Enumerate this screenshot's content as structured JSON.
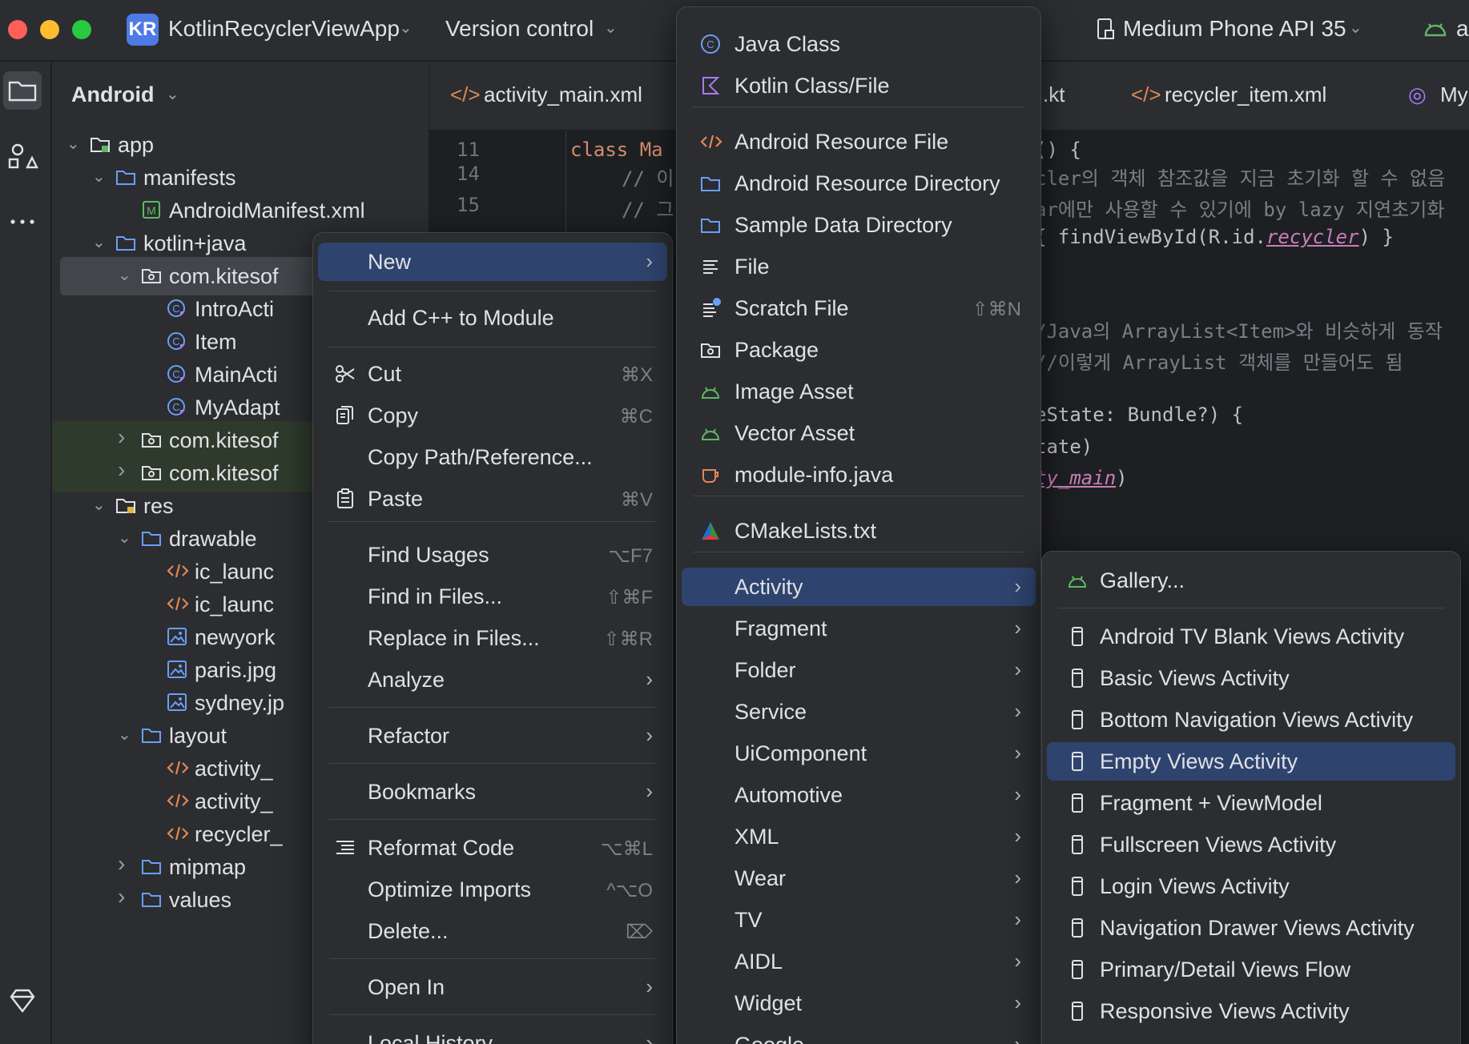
{
  "titlebar": {
    "project_badge": "KR",
    "project_name": "KotlinRecyclerViewApp",
    "vcs": "Version control",
    "device": "Medium Phone API 35",
    "run_partial": "a"
  },
  "project_panel": {
    "view": "Android",
    "tree": [
      {
        "label": "app",
        "icon": "module-icon"
      },
      {
        "label": "manifests",
        "icon": "folder-icon"
      },
      {
        "label": "AndroidManifest.xml",
        "icon": "manifest-icon"
      },
      {
        "label": "kotlin+java",
        "icon": "folder-icon"
      },
      {
        "label": "com.kitesof",
        "icon": "package-icon"
      },
      {
        "label": "IntroActi",
        "icon": "kotlin-class-icon"
      },
      {
        "label": "Item",
        "icon": "kotlin-class-icon"
      },
      {
        "label": "MainActi",
        "icon": "kotlin-class-icon"
      },
      {
        "label": "MyAdapt",
        "icon": "kotlin-class-icon"
      },
      {
        "label": "com.kitesof",
        "icon": "package-icon"
      },
      {
        "label": "com.kitesof",
        "icon": "package-icon"
      },
      {
        "label": "res",
        "icon": "res-folder-icon"
      },
      {
        "label": "drawable",
        "icon": "folder-icon"
      },
      {
        "label": "ic_launc",
        "icon": "xml-icon"
      },
      {
        "label": "ic_launc",
        "icon": "xml-icon"
      },
      {
        "label": "newyork",
        "icon": "image-icon"
      },
      {
        "label": "paris.jpg",
        "icon": "image-icon"
      },
      {
        "label": "sydney.jp",
        "icon": "image-icon"
      },
      {
        "label": "layout",
        "icon": "folder-icon"
      },
      {
        "label": "activity_",
        "icon": "xml-icon"
      },
      {
        "label": "activity_",
        "icon": "xml-icon"
      },
      {
        "label": "recycler_",
        "icon": "xml-icon"
      },
      {
        "label": "mipmap",
        "icon": "folder-icon"
      },
      {
        "label": "values",
        "icon": "folder-icon"
      }
    ]
  },
  "editor": {
    "tabs": [
      "activity_main.xml",
      ".kt",
      "recycler_item.xml",
      "My"
    ],
    "code": [
      {
        "no": "11",
        "text": "class Ma",
        "tail": "() {"
      },
      {
        "no": "14",
        "text": "// 이",
        "tail": "cler의 객체 참조값을 지금 초기화 할 수 없음"
      },
      {
        "no": "15",
        "text": "// 그",
        "tail": "ar에만 사용할 수 있기에 by lazy 지연초기화"
      },
      {
        "no": "",
        "text": "",
        "tail": " { findViewById(R.id.",
        "link": "recycler",
        "end": ") }"
      },
      {
        "no": "",
        "text": "",
        "tail": "/Java의 ArrayList<Item>와 비슷하게 동작"
      },
      {
        "no": "",
        "text": "",
        "tail": "//이렇게 ArrayList 객체를 만들어도 됨"
      },
      {
        "no": "",
        "text": "",
        "tail": "eState: Bundle?) {"
      },
      {
        "no": "",
        "text": "",
        "tail": "tate)"
      },
      {
        "no": "",
        "text": "",
        "tail": "",
        "link": "ty_main",
        "end": ")"
      }
    ]
  },
  "context_menu": {
    "items": [
      {
        "label": "New",
        "submenu": true,
        "highlight": true
      },
      {
        "label": "Add C++ to Module"
      },
      {
        "label": "Cut",
        "shortcut": "⌘X",
        "icon": "scissors-icon"
      },
      {
        "label": "Copy",
        "shortcut": "⌘C",
        "icon": "copy-icon"
      },
      {
        "label": "Copy Path/Reference..."
      },
      {
        "label": "Paste",
        "shortcut": "⌘V",
        "icon": "paste-icon"
      },
      {
        "label": "Find Usages",
        "shortcut": "⌥F7"
      },
      {
        "label": "Find in Files...",
        "shortcut": "⇧⌘F"
      },
      {
        "label": "Replace in Files...",
        "shortcut": "⇧⌘R"
      },
      {
        "label": "Analyze",
        "submenu": true
      },
      {
        "label": "Refactor",
        "submenu": true
      },
      {
        "label": "Bookmarks",
        "submenu": true
      },
      {
        "label": "Reformat Code",
        "shortcut": "⌥⌘L",
        "icon": "reformat-icon"
      },
      {
        "label": "Optimize Imports",
        "shortcut": "^⌥O"
      },
      {
        "label": "Delete...",
        "shortcut": "⌦"
      },
      {
        "label": "Open In",
        "submenu": true
      },
      {
        "label": "Local History",
        "submenu": true
      }
    ]
  },
  "new_menu": {
    "items": [
      {
        "label": "Java Class",
        "icon": "java-class-icon"
      },
      {
        "label": "Kotlin Class/File",
        "icon": "kotlin-icon"
      },
      {
        "label": "Android Resource File",
        "icon": "xml-icon"
      },
      {
        "label": "Android Resource Directory",
        "icon": "folder-icon"
      },
      {
        "label": "Sample Data Directory",
        "icon": "folder-icon"
      },
      {
        "label": "File",
        "icon": "file-icon"
      },
      {
        "label": "Scratch File",
        "icon": "scratch-file-icon",
        "shortcut": "⇧⌘N"
      },
      {
        "label": "Package",
        "icon": "package-icon"
      },
      {
        "label": "Image Asset",
        "icon": "android-icon"
      },
      {
        "label": "Vector Asset",
        "icon": "android-icon"
      },
      {
        "label": "module-info.java",
        "icon": "java-cup-icon"
      },
      {
        "label": "CMakeLists.txt",
        "icon": "cmake-icon"
      },
      {
        "label": "Activity",
        "submenu": true,
        "highlight": true
      },
      {
        "label": "Fragment",
        "submenu": true
      },
      {
        "label": "Folder",
        "submenu": true
      },
      {
        "label": "Service",
        "submenu": true
      },
      {
        "label": "UiComponent",
        "submenu": true
      },
      {
        "label": "Automotive",
        "submenu": true
      },
      {
        "label": "XML",
        "submenu": true
      },
      {
        "label": "Wear",
        "submenu": true
      },
      {
        "label": "TV",
        "submenu": true
      },
      {
        "label": "AIDL",
        "submenu": true
      },
      {
        "label": "Widget",
        "submenu": true
      },
      {
        "label": "Google",
        "submenu": true
      }
    ]
  },
  "activity_menu": {
    "items": [
      {
        "label": "Gallery...",
        "icon": "android-icon"
      },
      {
        "label": "Android TV Blank Views Activity"
      },
      {
        "label": "Basic Views Activity"
      },
      {
        "label": "Bottom Navigation Views Activity"
      },
      {
        "label": "Empty Views Activity",
        "highlight": true
      },
      {
        "label": "Fragment + ViewModel"
      },
      {
        "label": "Fullscreen Views Activity"
      },
      {
        "label": "Login Views Activity"
      },
      {
        "label": "Navigation Drawer Views Activity"
      },
      {
        "label": "Primary/Detail Views Flow"
      },
      {
        "label": "Responsive Views Activity"
      }
    ]
  },
  "colors": {
    "accent_highlight": "#2e436e",
    "android_green": "#5fb865",
    "kotlin_purple": "#a97bff",
    "xml_orange": "#e08855",
    "folder_blue": "#6c9ef8"
  }
}
